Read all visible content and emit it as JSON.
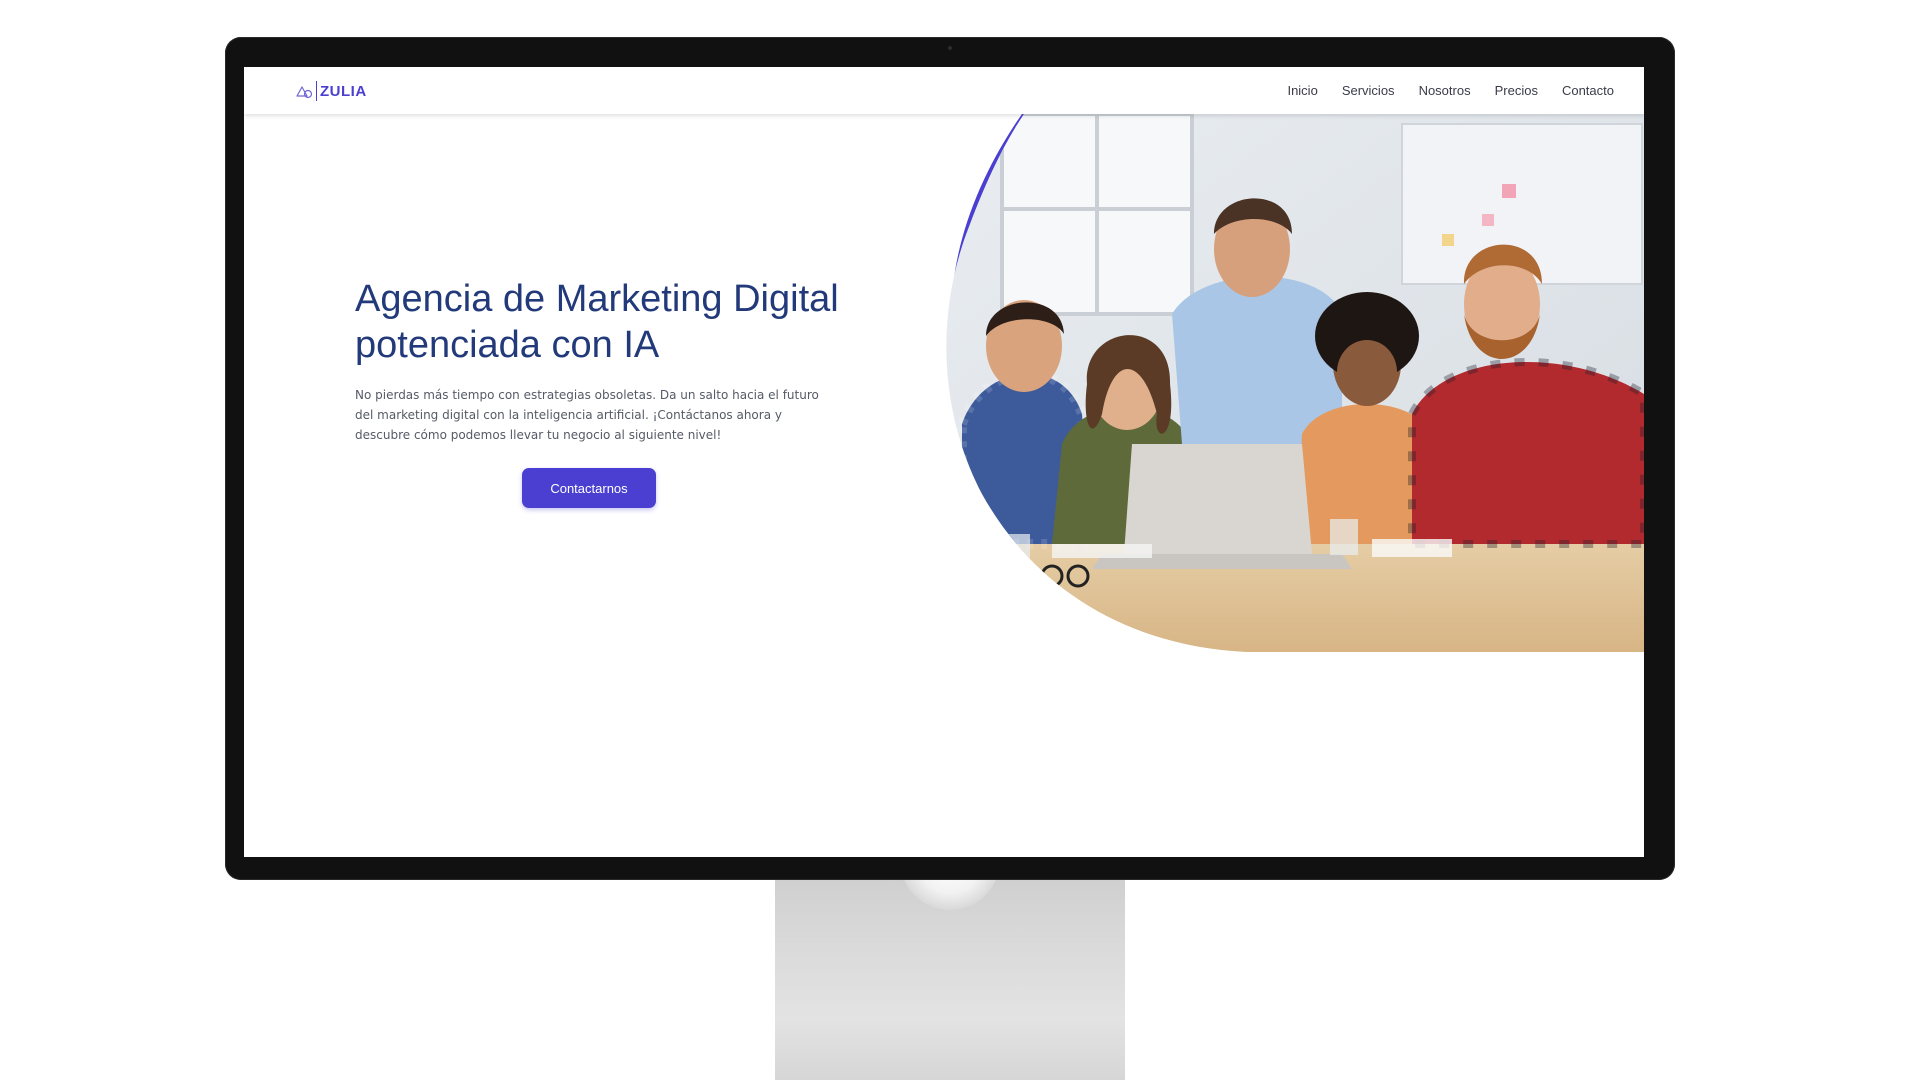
{
  "brand": {
    "name": "ZULIA",
    "logo_icon": "triangle-loop-logo-icon",
    "accent_color": "#4a3fd1",
    "heading_color": "#233a7a"
  },
  "nav": {
    "items": [
      {
        "label": "Inicio"
      },
      {
        "label": "Servicios"
      },
      {
        "label": "Nosotros"
      },
      {
        "label": "Precios"
      },
      {
        "label": "Contacto"
      }
    ]
  },
  "hero": {
    "title": "Agencia de Marketing Digital potenciada con IA",
    "description": "No pierdas más tiempo con estrategias obsoletas. Da un salto hacia el futuro del marketing digital con la inteligencia artificial. ¡Contáctanos ahora y descubre cómo podemos llevar tu negocio al siguiente nivel!",
    "cta_label": "Contactarnos",
    "image": "team-working-at-laptop-photo"
  }
}
